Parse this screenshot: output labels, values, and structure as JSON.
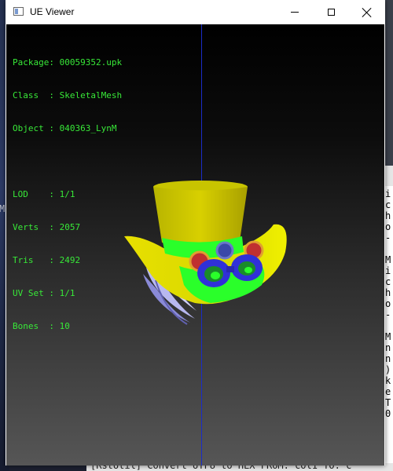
{
  "window": {
    "title": "UE Viewer",
    "controls": {
      "minimize": "minimize",
      "maximize": "maximize",
      "close": "close"
    }
  },
  "info": {
    "package_label": "Package: ",
    "package_value": "00059352.upk",
    "class_label": "Class  : ",
    "class_value": "SkeletalMesh",
    "object_label": "Object : ",
    "object_value": "040363_LynM",
    "lod_label": "LOD    : ",
    "lod_value": "1/1",
    "verts_label": "Verts  : ",
    "verts_value": "2057",
    "tris_label": "Tris   : ",
    "tris_value": "2492",
    "uvset_label": "UV Set : ",
    "uvset_value": "1/1",
    "bones_label": "Bones  : ",
    "bones_value": "10"
  },
  "viewport": {
    "model": "steampunk-top-hat-mesh",
    "colors": {
      "hat": "#d8d000",
      "band": "#2aff2a",
      "goggles": "#3030d8",
      "axis": "#1a2cc8",
      "text": "#38e838"
    }
  },
  "background": {
    "left_glyph": "M",
    "right_lines": [
      "i",
      "c",
      "h",
      "o",
      "-",
      "",
      "M",
      "i",
      "c",
      "h",
      "o",
      "-",
      "",
      "M",
      "n",
      "n",
      ")",
      "k",
      "e",
      "T",
      "0"
    ],
    "console_text": "[RstUtil] Convert UTF8 to HEX  FROM: col1  TO: c"
  }
}
